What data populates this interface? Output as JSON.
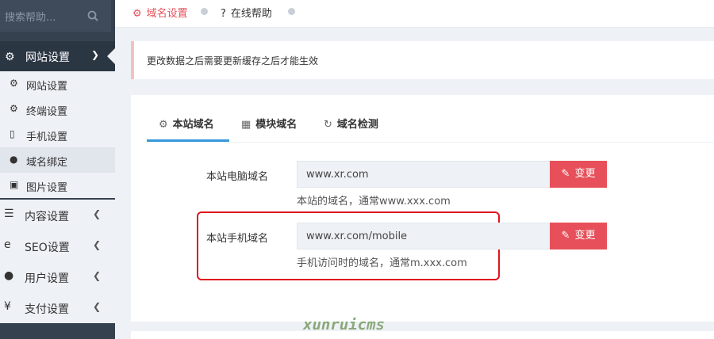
{
  "search": {
    "placeholder": "搜索帮助..."
  },
  "sidebar": {
    "active_group": {
      "label": "网站设置"
    },
    "sub_items": [
      {
        "label": "网站设置",
        "icon": "gear-icon"
      },
      {
        "label": "终端设置",
        "icon": "gears-icon"
      },
      {
        "label": "手机设置",
        "icon": "mobile-icon"
      },
      {
        "label": "域名绑定",
        "icon": "globe-icon"
      },
      {
        "label": "图片设置",
        "icon": "image-icon"
      }
    ],
    "main_items": [
      {
        "label": "内容设置",
        "icon": "list-icon"
      },
      {
        "label": "SEO设置",
        "icon": "ie-icon"
      },
      {
        "label": "用户设置",
        "icon": "user-icon"
      },
      {
        "label": "支付设置",
        "icon": "yen-icon"
      }
    ]
  },
  "breadcrumb": {
    "item1": "域名设置",
    "item2": "在线帮助"
  },
  "notice": "更改数据之后需要更新缓存之后才能生效",
  "tabs": [
    {
      "label": "本站域名"
    },
    {
      "label": "模块域名"
    },
    {
      "label": "域名检测"
    }
  ],
  "form": {
    "pc": {
      "label": "本站电脑域名",
      "value": "www.xr.com",
      "help": "本站的域名，通常www.xxx.com",
      "button": "变更"
    },
    "mobile": {
      "label": "本站手机域名",
      "value": "www.xr.com/mobile",
      "help": "手机访问时的域名，通常m.xxx.com",
      "button": "变更"
    }
  },
  "watermark": "xunruicms",
  "colors": {
    "accent": "#e7505a",
    "tab_active": "#3598dc",
    "sidebar": "#364150",
    "highlight": "#e0161e"
  }
}
